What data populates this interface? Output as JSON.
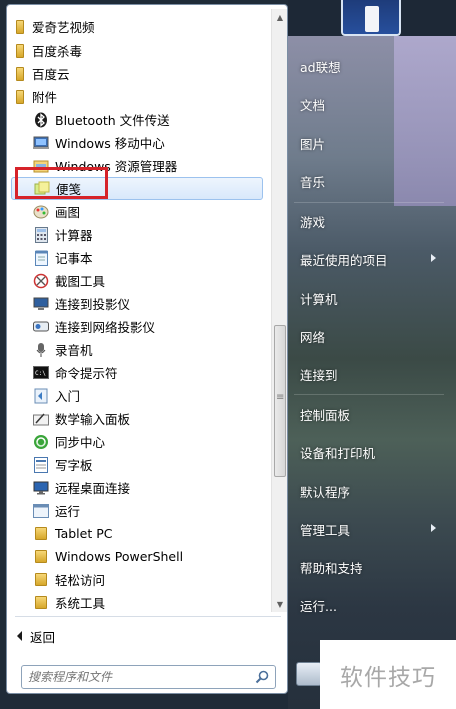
{
  "programs": {
    "folders_top": [
      {
        "label": "爱奇艺视频",
        "icon": "folder-icon"
      },
      {
        "label": "百度杀毒",
        "icon": "folder-icon"
      },
      {
        "label": "百度云",
        "icon": "folder-icon"
      },
      {
        "label": "附件",
        "icon": "folder-open-icon"
      }
    ],
    "accessories": [
      {
        "label": "Bluetooth 文件传送",
        "icon": "bluetooth-icon"
      },
      {
        "label": "Windows 移动中心",
        "icon": "mobility-center-icon"
      },
      {
        "label": "Windows 资源管理器",
        "icon": "explorer-icon"
      },
      {
        "label": "便笺",
        "icon": "sticky-notes-icon"
      },
      {
        "label": "画图",
        "icon": "paint-icon"
      },
      {
        "label": "计算器",
        "icon": "calculator-icon"
      },
      {
        "label": "记事本",
        "icon": "notepad-icon"
      },
      {
        "label": "截图工具",
        "icon": "snipping-tool-icon"
      },
      {
        "label": "连接到投影仪",
        "icon": "projector-icon"
      },
      {
        "label": "连接到网络投影仪",
        "icon": "network-projector-icon"
      },
      {
        "label": "录音机",
        "icon": "sound-recorder-icon"
      },
      {
        "label": "命令提示符",
        "icon": "cmd-icon"
      },
      {
        "label": "入门",
        "icon": "getting-started-icon"
      },
      {
        "label": "数学输入面板",
        "icon": "math-input-icon"
      },
      {
        "label": "同步中心",
        "icon": "sync-center-icon"
      },
      {
        "label": "写字板",
        "icon": "wordpad-icon"
      },
      {
        "label": "远程桌面连接",
        "icon": "remote-desktop-icon"
      },
      {
        "label": "运行",
        "icon": "run-icon"
      },
      {
        "label": "Tablet PC",
        "icon": "folder-icon"
      },
      {
        "label": "Windows PowerShell",
        "icon": "folder-icon"
      },
      {
        "label": "轻松访问",
        "icon": "folder-icon"
      },
      {
        "label": "系统工具",
        "icon": "folder-icon"
      }
    ],
    "selected": "便笺"
  },
  "back_label": "返回",
  "search": {
    "placeholder": "搜索程序和文件"
  },
  "right_links": [
    {
      "label": "ad联想",
      "has_submenu": false
    },
    {
      "label": "文档",
      "has_submenu": false
    },
    {
      "label": "图片",
      "has_submenu": false
    },
    {
      "label": "音乐",
      "has_submenu": false
    },
    {
      "label": "游戏",
      "has_submenu": false
    },
    {
      "label": "最近使用的项目",
      "has_submenu": true
    },
    {
      "label": "计算机",
      "has_submenu": false
    },
    {
      "label": "网络",
      "has_submenu": false
    },
    {
      "label": "连接到",
      "has_submenu": false
    },
    {
      "label": "控制面板",
      "has_submenu": false
    },
    {
      "label": "设备和打印机",
      "has_submenu": false
    },
    {
      "label": "默认程序",
      "has_submenu": false
    },
    {
      "label": "管理工具",
      "has_submenu": true
    },
    {
      "label": "帮助和支持",
      "has_submenu": false
    },
    {
      "label": "运行...",
      "has_submenu": false
    }
  ],
  "watermark": "软件技巧",
  "colors": {
    "highlight_box": "#d6232a",
    "selection": "#d9e8fb"
  }
}
